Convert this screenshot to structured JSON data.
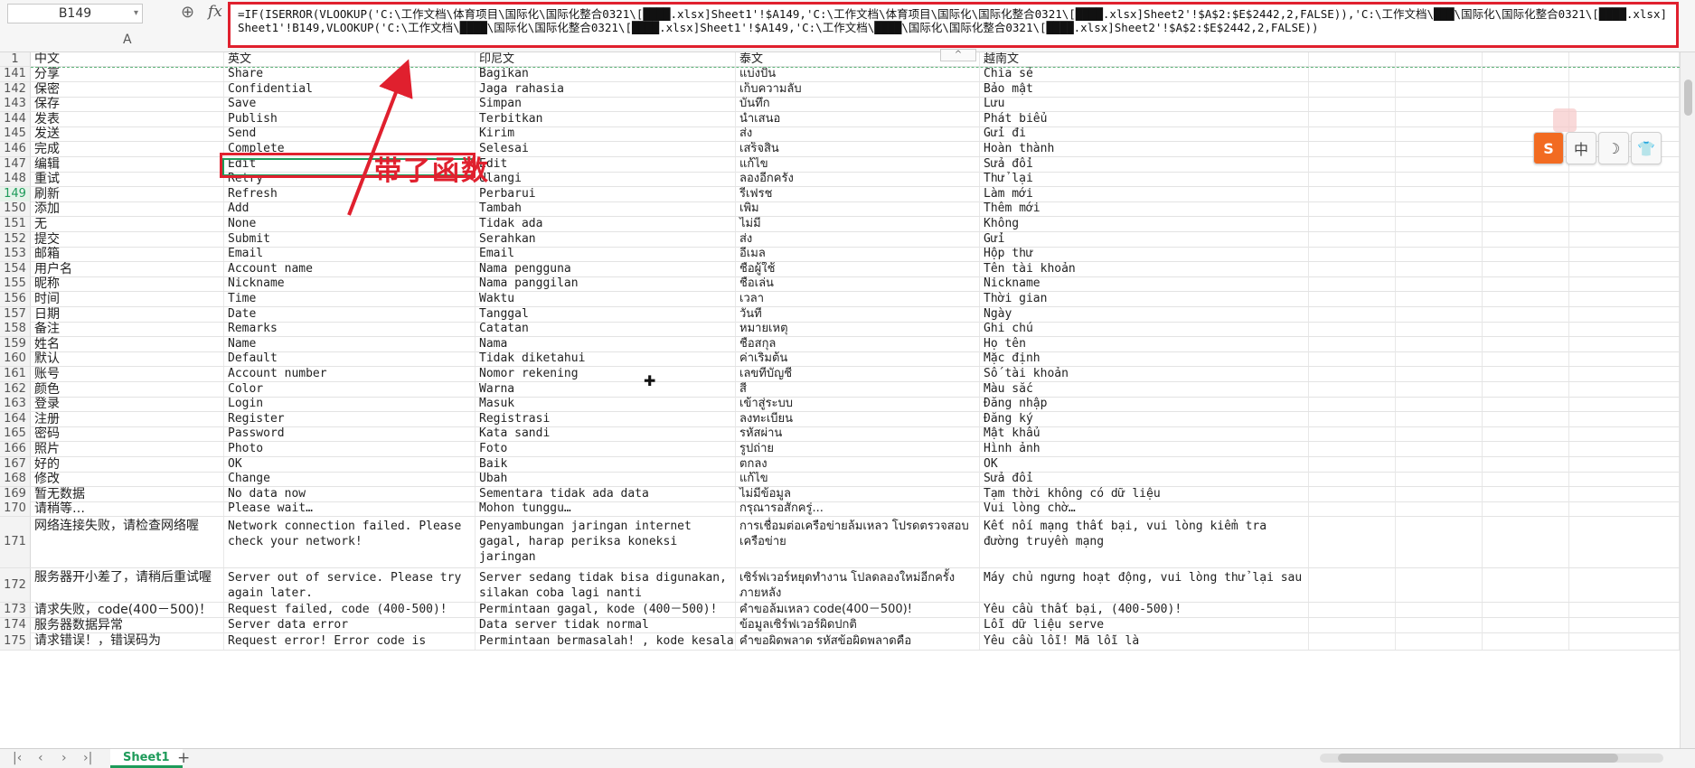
{
  "formula_bar": {
    "cell_ref": "B149",
    "fx_label": "fx",
    "formula": "=IF(ISERROR(VLOOKUP('C:\\工作文档\\体育项目\\国际化\\国际化整合0321\\[████.xlsx]Sheet1'!$A149,'C:\\工作文档\\体育项目\\国际化\\国际化整合0321\\[████.xlsx]Sheet2'!$A$2:$E$2442,2,FALSE)),'C:\\工作文档\\███\\国际化\\国际化整合0321\\[████.xlsx]Sheet1'!B149,VLOOKUP('C:\\工作文档\\████\\国际化\\国际化整合0321\\[████.xlsx]Sheet1'!$A149,'C:\\工作文档\\████\\国际化\\国际化整合0321\\[████.xlsx]Sheet2'!$A$2:$E$2442,2,FALSE))",
    "column_label": "A"
  },
  "annotation": {
    "text": "带了函数",
    "color": "#e0202e"
  },
  "header_row": {
    "num": "1",
    "zh": "中文",
    "en": "英文",
    "id": "印尼文",
    "th": "泰文",
    "vi": "越南文"
  },
  "rows": [
    {
      "num": "141",
      "zh": "分享",
      "en": "Share",
      "id": "Bagikan",
      "th": "แบ่งปัน",
      "vi": "Chia sẻ"
    },
    {
      "num": "142",
      "zh": "保密",
      "en": "Confidential",
      "id": "Jaga rahasia",
      "th": "เก็บความลับ",
      "vi": "Bảo mật"
    },
    {
      "num": "143",
      "zh": "保存",
      "en": "Save",
      "id": "Simpan",
      "th": "บันทึก",
      "vi": "Lưu"
    },
    {
      "num": "144",
      "zh": "发表",
      "en": "Publish",
      "id": "Terbitkan",
      "th": "นำเสนอ",
      "vi": "Phát biểu"
    },
    {
      "num": "145",
      "zh": "发送",
      "en": "Send",
      "id": "Kirim",
      "th": "ส่ง",
      "vi": "Gửi đi"
    },
    {
      "num": "146",
      "zh": "完成",
      "en": "Complete",
      "id": "Selesai",
      "th": "เสร็จสิ้น",
      "vi": "Hoàn thành"
    },
    {
      "num": "147",
      "zh": "编辑",
      "en": "Edit",
      "id": "Edit",
      "th": "แก้ไข",
      "vi": "Sửa đổi"
    },
    {
      "num": "148",
      "zh": "重试",
      "en": "Retry",
      "id": "Ulangi",
      "th": "ลองอีกครั้ง",
      "vi": "Thử lại"
    },
    {
      "num": "149",
      "zh": "刷新",
      "en": "Refresh",
      "id": "Perbarui",
      "th": "รีเฟรช",
      "vi": "Làm mới"
    },
    {
      "num": "150",
      "zh": "添加",
      "en": "Add",
      "id": "Tambah",
      "th": "เพิ่ม",
      "vi": "Thêm mới"
    },
    {
      "num": "151",
      "zh": "无",
      "en": "None",
      "id": "Tidak ada",
      "th": "ไม่มี",
      "vi": "Không"
    },
    {
      "num": "152",
      "zh": "提交",
      "en": "Submit",
      "id": "Serahkan",
      "th": "ส่ง",
      "vi": "Gửi"
    },
    {
      "num": "153",
      "zh": "邮箱",
      "en": "Email",
      "id": "Email",
      "th": "อีเมล",
      "vi": "Hộp thư"
    },
    {
      "num": "154",
      "zh": "用户名",
      "en": "Account name",
      "id": "Nama pengguna",
      "th": "ชื่อผู้ใช้",
      "vi": "Tên tài khoản"
    },
    {
      "num": "155",
      "zh": "昵称",
      "en": "Nickname",
      "id": "Nama panggilan",
      "th": "ชื่อเล่น",
      "vi": "Nickname"
    },
    {
      "num": "156",
      "zh": "时间",
      "en": "Time",
      "id": "Waktu",
      "th": "เวลา",
      "vi": "Thời gian"
    },
    {
      "num": "157",
      "zh": "日期",
      "en": "Date",
      "id": "Tanggal",
      "th": "วันที่",
      "vi": "Ngày"
    },
    {
      "num": "158",
      "zh": "备注",
      "en": "Remarks",
      "id": "Catatan",
      "th": "หมายเหตุ",
      "vi": "Ghi chú"
    },
    {
      "num": "159",
      "zh": "姓名",
      "en": "Name",
      "id": "Nama",
      "th": "ชื่อสกุล",
      "vi": "Họ tên"
    },
    {
      "num": "160",
      "zh": "默认",
      "en": "Default",
      "id": "Tidak diketahui",
      "th": "ค่าเริ่มต้น",
      "vi": "Mặc định"
    },
    {
      "num": "161",
      "zh": "账号",
      "en": "Account number",
      "id": "Nomor rekening",
      "th": "เลขที่บัญชี",
      "vi": "Số tài khoản"
    },
    {
      "num": "162",
      "zh": "颜色",
      "en": "Color",
      "id": "Warna",
      "th": "สี",
      "vi": "Màu sắc"
    },
    {
      "num": "163",
      "zh": "登录",
      "en": "Login",
      "id": "Masuk",
      "th": "เข้าสู่ระบบ",
      "vi": "Đăng nhập"
    },
    {
      "num": "164",
      "zh": "注册",
      "en": "Register",
      "id": "Registrasi",
      "th": "ลงทะเบียน",
      "vi": "Đăng ký"
    },
    {
      "num": "165",
      "zh": "密码",
      "en": "Password",
      "id": "Kata sandi",
      "th": "รหัสผ่าน",
      "vi": "Mật khẩu"
    },
    {
      "num": "166",
      "zh": "照片",
      "en": "Photo",
      "id": "Foto",
      "th": "รูปถ่าย",
      "vi": "Hình ảnh"
    },
    {
      "num": "167",
      "zh": "好的",
      "en": "OK",
      "id": "Baik",
      "th": "ตกลง",
      "vi": "OK"
    },
    {
      "num": "168",
      "zh": "修改",
      "en": "Change",
      "id": "Ubah",
      "th": "แก้ไข",
      "vi": "Sửa đổi"
    },
    {
      "num": "169",
      "zh": "暂无数据",
      "en": "No data now",
      "id": "Sementara tidak ada data",
      "th": "ไม่มีข้อมูล",
      "vi": "Tạm thời không có dữ liệu"
    },
    {
      "num": "170",
      "zh": "请稍等…",
      "en": "Please wait…",
      "id": "Mohon tunggu…",
      "th": "กรุณารอสักครู่...",
      "vi": "Vui lòng chờ…"
    },
    {
      "num": "171",
      "zh": "网络连接失败，请检查网络喔",
      "en": "Network connection failed. Please check your network!",
      "id": "Penyambungan jaringan internet gagal, harap periksa koneksi jaringan",
      "th": "การเชื่อมต่อเครือข่ายล้มเหลว โปรดตรวจสอบเครือข่าย",
      "vi": "Kết nối mạng thất bại, vui lòng kiểm tra đường truyền mạng"
    },
    {
      "num": "172",
      "zh": "服务器开小差了，请稍后重试喔",
      "en": "Server out of service. Please try again later.",
      "id": "Server sedang tidak bisa digunakan, silakan coba lagi nanti",
      "th": "เซิร์ฟเวอร์หยุดทำงาน โปลดลองใหม่อีกครั้งภายหลัง",
      "vi": "Máy chủ ngưng hoạt động, vui lòng thử lại sau"
    },
    {
      "num": "173",
      "zh": "请求失败，code(400－500)！",
      "en": "Request failed, code (400-500)!",
      "id": "Permintaan gagal, kode (400－500)!",
      "th": "คำขอล้มเหลว code(400－500)!",
      "vi": "Yêu cầu thất bại, (400-500)!"
    },
    {
      "num": "174",
      "zh": "服务器数据异常",
      "en": "Server data error",
      "id": "Data server tidak normal",
      "th": "ข้อมูลเซิร์ฟเวอร์ผิดปกติ",
      "vi": "Lỗi dữ liệu serve"
    },
    {
      "num": "175",
      "zh": "请求错误！，错误码为",
      "en": "Request error! Error code is",
      "id": "Permintaan bermasalah!  , kode kesalahannya dikarenakan",
      "th": "คำขอผิดพลาด  รหัสข้อผิดพลาดคือ",
      "vi": "Yêu cầu lỗi! Mã lỗi là"
    }
  ],
  "float_toolbar": [
    {
      "icon": "sogou-logo-icon",
      "glyph": "S"
    },
    {
      "icon": "chinese-input-icon",
      "glyph": "中"
    },
    {
      "icon": "moon-icon",
      "glyph": "☽"
    },
    {
      "icon": "shirt-icon",
      "glyph": "👕"
    }
  ],
  "sheet_tabs": {
    "active": "Sheet1",
    "add": "+"
  },
  "colors": {
    "accent": "#1e9b5a",
    "annotation_red": "#e0202e"
  }
}
